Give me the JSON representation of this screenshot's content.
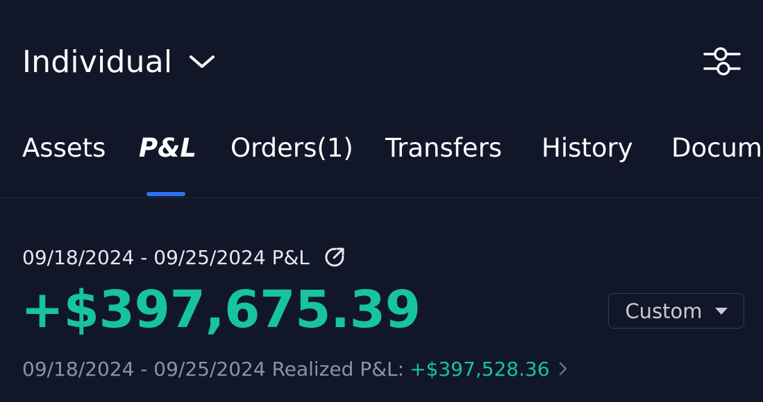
{
  "header": {
    "account_name": "Individual",
    "dropdown_icon": "chevron-down-icon",
    "filter_icon": "sliders-icon"
  },
  "tabs": [
    {
      "label": "Assets",
      "active": false
    },
    {
      "label": "P&L",
      "active": true
    },
    {
      "label": "Orders(1)",
      "active": false
    },
    {
      "label": "Transfers",
      "active": false
    },
    {
      "label": "History",
      "active": false
    },
    {
      "label": "Documents",
      "active": false
    }
  ],
  "pl": {
    "range_label": "09/18/2024 - 09/25/2024 P&L",
    "share_icon": "share-external-icon",
    "total_value": "+$397,675.39",
    "period_selector": "Custom",
    "realized_label": "09/18/2024 - 09/25/2024 Realized P&L:",
    "realized_value": "+$397,528.36"
  },
  "colors": {
    "background": "#111728",
    "positive": "#17c3a0",
    "accent": "#2f6ff5",
    "text_secondary": "#8d93a3"
  }
}
